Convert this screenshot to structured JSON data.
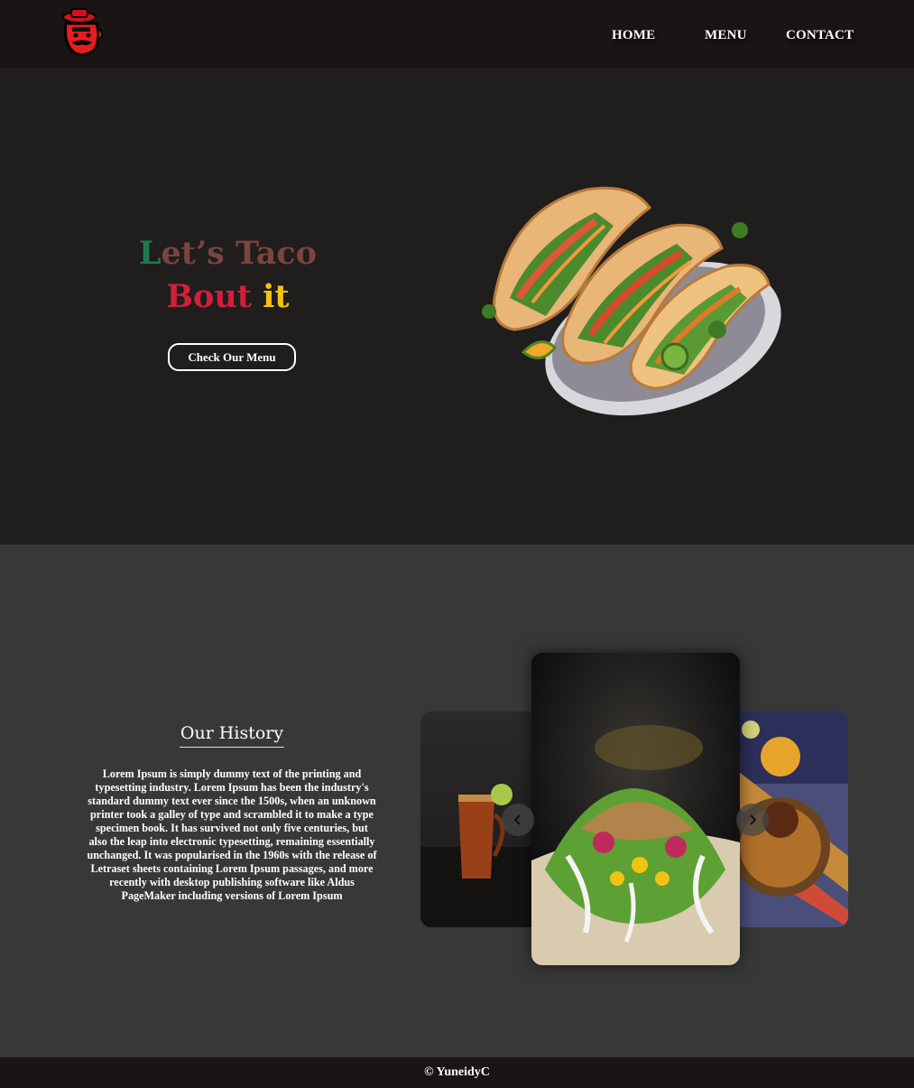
{
  "nav": {
    "home_label": "HOME",
    "menu_label": "MENU",
    "contact_label": "CONTACT"
  },
  "hero": {
    "title_part1": "L",
    "title_part2": "et’s Taco",
    "title_part3": "Bout",
    "title_part4": "it",
    "cta_label": "Check Our Menu"
  },
  "history": {
    "title": "Our History",
    "body": "Lorem Ipsum is simply dummy text of the printing and typesetting industry. Lorem Ipsum has been the industry's standard dummy text ever since the 1500s, when an unknown printer took a galley of  type and scrambled it to make a type specimen book. It has survived not  only five centuries, but also the leap into electronic typesetting,  remaining essentially unchanged. It was popularised in the 1960s with  the release of Letraset sheets containing Lorem Ipsum passages, and more recently with desktop publishing software like Aldus PageMaker  including versions of Lorem Ipsum"
  },
  "footer": {
    "copyright": "©  YuneidyC"
  },
  "colors": {
    "header_bg": "#1a1414",
    "hero_bg": "#201d1d",
    "history_bg": "#383838",
    "accent_green": "#1e7a53",
    "accent_brown": "#7a4440",
    "accent_red": "#d0203a",
    "accent_yellow": "#f2c313"
  },
  "icons": {
    "logo": "mexican-hat-face-icon",
    "prev": "chevron-left-icon",
    "next": "chevron-right-icon"
  }
}
